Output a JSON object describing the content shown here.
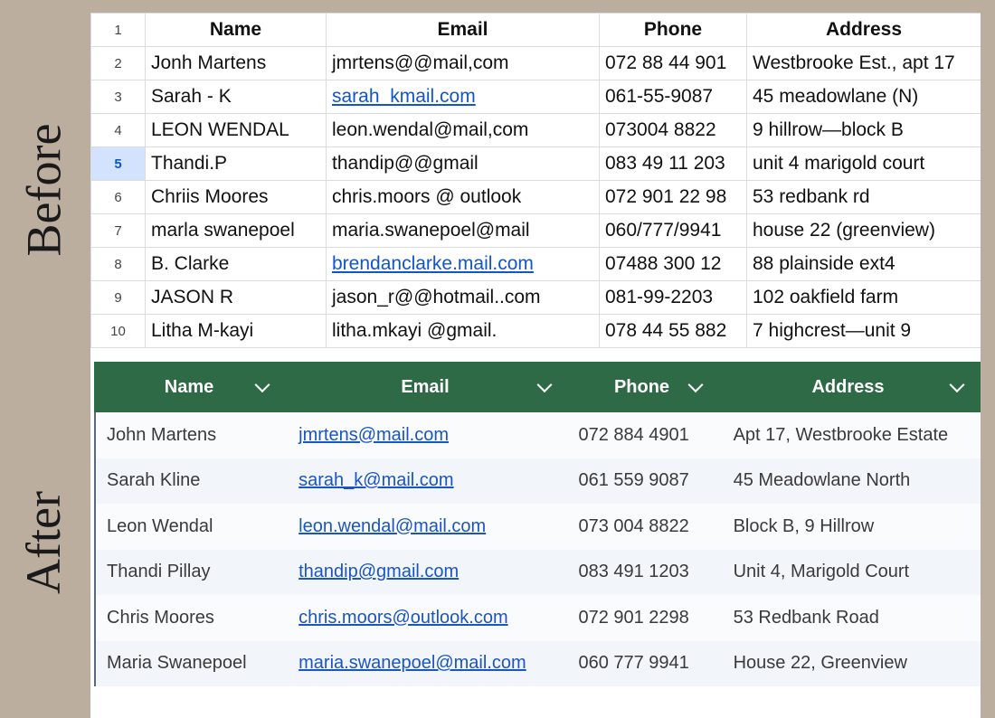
{
  "labels": {
    "before": "Before",
    "after": "After"
  },
  "before": {
    "headers": [
      "Name",
      "Email",
      "Phone",
      "Address"
    ],
    "header_row_number": "1",
    "selected_row": "5",
    "rows": [
      {
        "n": "2",
        "name": "Jonh Martens",
        "email": "jmrtens@@mail,com",
        "email_link": false,
        "phone": "072 88 44 901",
        "address": "Westbrooke Est., apt 17"
      },
      {
        "n": "3",
        "name": "Sarah - K",
        "email": "sarah_kmail.com",
        "email_link": true,
        "phone": "061-55-9087",
        "address": "45 meadowlane (N)"
      },
      {
        "n": "4",
        "name": "LEON WENDAL",
        "email": "leon.wendal@mail,com",
        "email_link": false,
        "phone": "073004 8822",
        "address": "9 hillrow—block B"
      },
      {
        "n": "5",
        "name": "Thandi.P",
        "email": "thandip@@gmail",
        "email_link": false,
        "phone": "083 49 11 203",
        "address": "unit 4 marigold court"
      },
      {
        "n": "6",
        "name": "Chriis Moores",
        "email": "chris.moors @ outlook",
        "email_link": false,
        "phone": "072 901 22 98",
        "address": "53 redbank rd"
      },
      {
        "n": "7",
        "name": "marla swanepoel",
        "email": "maria.swanepoel@mail",
        "email_link": false,
        "phone": "060/777/9941",
        "address": "house 22 (greenview)"
      },
      {
        "n": "8",
        "name": "B. Clarke",
        "email": "brendanclarke.mail.com",
        "email_link": true,
        "phone": "07488 300 12",
        "address": "88 plainside ext4"
      },
      {
        "n": "9",
        "name": "JASON R",
        "email": "jason_r@@hotmail..com",
        "email_link": false,
        "phone": "081-99-2203",
        "address": "102 oakfield farm"
      },
      {
        "n": "10",
        "name": "Litha M-kayi",
        "email": "litha.mkayi @gmail.",
        "email_link": false,
        "phone": "078 44 55 882",
        "address": "7 highcrest—unit 9"
      }
    ]
  },
  "after": {
    "headers": [
      "Name",
      "Email",
      "Phone",
      "Address"
    ],
    "rows": [
      {
        "name": "John Martens",
        "email": "jmrtens@mail.com",
        "phone": "072 884 4901",
        "address": "Apt 17, Westbrooke Estate"
      },
      {
        "name": "Sarah Kline",
        "email": "sarah_k@mail.com",
        "phone": "061 559 9087",
        "address": "45 Meadowlane North"
      },
      {
        "name": "Leon Wendal",
        "email": "leon.wendal@mail.com",
        "phone": "073 004 8822",
        "address": "Block B, 9 Hillrow"
      },
      {
        "name": "Thandi Pillay",
        "email": "thandip@gmail.com",
        "phone": "083 491 1203",
        "address": "Unit 4, Marigold Court"
      },
      {
        "name": "Chris Moores",
        "email": "chris.moors@outlook.com",
        "phone": "072 901 2298",
        "address": "53 Redbank Road"
      },
      {
        "name": "Maria Swanepoel",
        "email": "maria.swanepoel@mail.com",
        "phone": "060 777 9941",
        "address": "House 22, Greenview"
      }
    ]
  }
}
